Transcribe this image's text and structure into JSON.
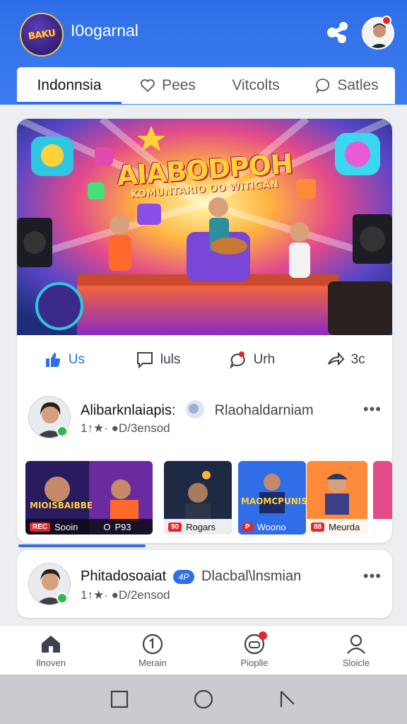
{
  "header": {
    "app_title": "I0ogarnal",
    "logo_text": "BAKU",
    "icons": [
      "share-icon",
      "profile-avatar"
    ]
  },
  "tabs": [
    {
      "label": "Indonnsia",
      "icon": "",
      "active": true
    },
    {
      "label": "Pees",
      "icon": "heart-icon",
      "active": false
    },
    {
      "label": "Vitcolts",
      "icon": "",
      "active": false
    },
    {
      "label": "Satles",
      "icon": "chat-bubble-icon",
      "active": false
    }
  ],
  "post": {
    "hero_title": "AIABODPOH",
    "hero_subtitle": "KOMUNTARIO OO WITIGAN",
    "actions": [
      {
        "label": "Us",
        "icon": "thumbs-up-icon"
      },
      {
        "label": "luls",
        "icon": "comment-icon"
      },
      {
        "label": "Urh",
        "icon": "message-icon"
      },
      {
        "label": "3c",
        "icon": "share-arrow-icon"
      }
    ],
    "author": {
      "name": "Alibarknlaiapis:",
      "name_suffix": "Rlaohaldarniam",
      "meta": "1↑★· ●D/3ensod",
      "more": "•••"
    },
    "thumbnails": [
      {
        "label": "Sooin",
        "badge": "REC",
        "style": "dark",
        "title": "MIOISBAIBBE"
      },
      {
        "label": "P93",
        "badge": "O",
        "style": "dark",
        "title": ""
      },
      {
        "label": "Rogars",
        "badge": "90",
        "style": "light",
        "title": ""
      },
      {
        "label": "Woono",
        "badge": "P",
        "style": "blue",
        "title": "MAOMCPUNIS"
      },
      {
        "label": "Meurda",
        "badge": "88",
        "style": "light",
        "title": ""
      },
      {
        "label": "",
        "badge": "",
        "style": "light",
        "title": ""
      }
    ]
  },
  "post2": {
    "author": {
      "name": "Phitadosoaiat",
      "name_suffix": "Dlacbal\\lnsmian",
      "meta": "1↑★· ●D/2ensod",
      "more": "•••"
    },
    "pill_text": "4P"
  },
  "bottom_nav": [
    {
      "label": "Ilnoven",
      "icon": "home-icon"
    },
    {
      "label": "Merain",
      "icon": "clock-icon"
    },
    {
      "label": "Pioplle",
      "icon": "people-icon"
    },
    {
      "label": "Sloicle",
      "icon": "profile-icon"
    }
  ],
  "colors": {
    "accent": "#2f6ee6",
    "online": "#2fb84c",
    "badge": "#e5262c"
  }
}
